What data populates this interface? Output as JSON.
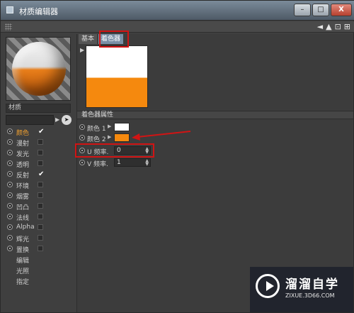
{
  "window": {
    "title": "材质编辑器"
  },
  "window_controls": {
    "minimize": "–",
    "maximize": "□",
    "close": "X"
  },
  "toolbar": {
    "icons": [
      "arrow-left-icon",
      "arrow-up-icon",
      "lock-icon",
      "expand-icon"
    ]
  },
  "material": {
    "name": "材质"
  },
  "channels": [
    {
      "label": "颜色",
      "checked": true,
      "active": true
    },
    {
      "label": "漫射",
      "checked": false
    },
    {
      "label": "发光",
      "checked": false
    },
    {
      "label": "透明",
      "checked": false
    },
    {
      "label": "反射",
      "checked": true
    },
    {
      "label": "环境",
      "checked": false
    },
    {
      "label": "烟雾",
      "checked": false
    },
    {
      "label": "凹凸",
      "checked": false
    },
    {
      "label": "法线",
      "checked": false
    },
    {
      "label": "Alpha",
      "checked": false
    },
    {
      "label": "辉光",
      "checked": false
    },
    {
      "label": "置换",
      "checked": false
    }
  ],
  "extra_items": [
    "编辑",
    "光照",
    "指定"
  ],
  "tabs": [
    {
      "label": "基本",
      "active": false
    },
    {
      "label": "着色器",
      "active": true
    }
  ],
  "shader": {
    "section_title": "着色器属性",
    "color1": {
      "label": "颜色 1",
      "hex": "#ffffff"
    },
    "color2": {
      "label": "颜色 2",
      "hex": "#f5890e"
    },
    "u_freq": {
      "label": "U 频率.",
      "value": "0"
    },
    "v_freq": {
      "label": "V 频率.",
      "value": "1"
    }
  },
  "watermark": {
    "text": "溜溜自学",
    "url": "ZIXUE.3D66.COM"
  },
  "colors": {
    "accent": "#f0a030",
    "highlight": "#d11414",
    "tab_active": "#7a8fa6"
  }
}
